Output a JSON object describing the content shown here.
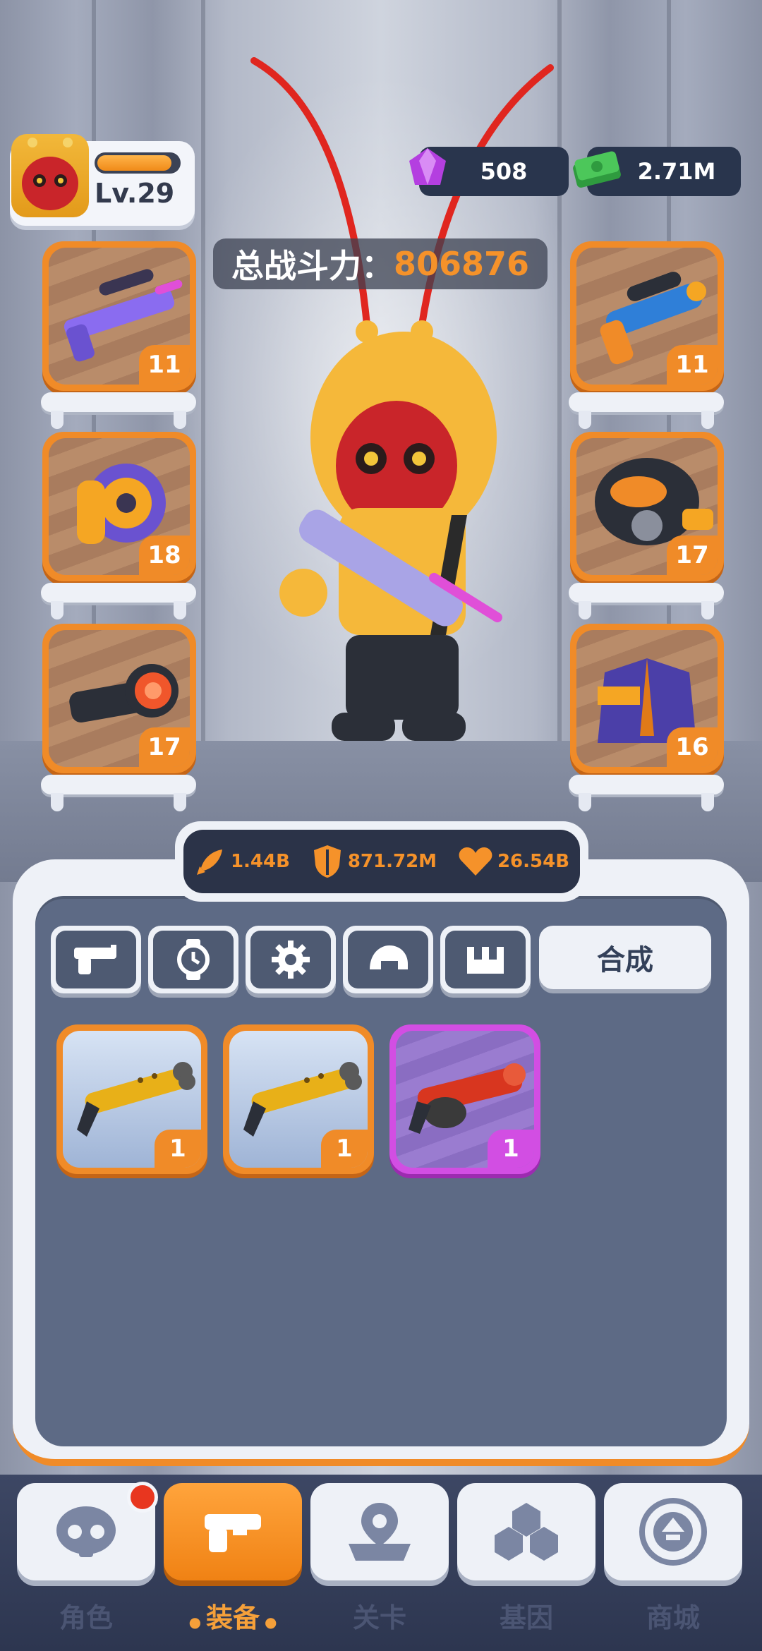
{
  "player": {
    "level": "Lv.29",
    "xp_fraction": 0.92
  },
  "currency": {
    "gems": "508",
    "cash": "2.71M"
  },
  "power": {
    "label": "总战斗力：",
    "value": "806876"
  },
  "equipment": {
    "left": [
      {
        "name": "sniper-rifle",
        "level": "11"
      },
      {
        "name": "shield-gear",
        "level": "18"
      },
      {
        "name": "scope",
        "level": "17"
      }
    ],
    "right": [
      {
        "name": "blaster-pistol",
        "level": "11"
      },
      {
        "name": "gas-mask",
        "level": "17"
      },
      {
        "name": "jacket",
        "level": "16"
      }
    ]
  },
  "stats": {
    "attack": "1.44B",
    "defense": "871.72M",
    "health": "26.54B"
  },
  "inventory": {
    "merge_label": "合成",
    "items": [
      {
        "name": "golden-shotgun",
        "count": "1",
        "rarity": "orange"
      },
      {
        "name": "golden-shotgun",
        "count": "1",
        "rarity": "orange"
      },
      {
        "name": "red-shotgun",
        "count": "1",
        "rarity": "purple"
      }
    ]
  },
  "nav": {
    "role": "角色",
    "equip": "装备",
    "stage": "关卡",
    "gene": "基因",
    "shop": "商城"
  },
  "colors": {
    "accent": "#f08b28",
    "purple": "#d24ee3",
    "dark": "#2b3348"
  }
}
